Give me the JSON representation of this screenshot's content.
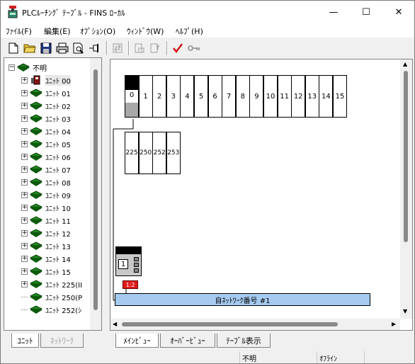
{
  "window": {
    "title": "PLCﾙｰﾁﾝｸﾞ ﾃｰﾌﾞﾙ - FINS ﾛｰｶﾙ",
    "minimize": "—",
    "maximize": "☐",
    "close": "✕"
  },
  "menu": [
    "ﾌｧｲﾙ(F)",
    "編集(E)",
    "ｵﾌﾟｼｮﾝ(O)",
    "ｳｨﾝﾄﾞｳ(W)",
    "ﾍﾙﾌﾟ(H)"
  ],
  "tree": {
    "root": "不明",
    "items": [
      "ﾕﾆｯﾄ 00",
      "ﾕﾆｯﾄ 01",
      "ﾕﾆｯﾄ 02",
      "ﾕﾆｯﾄ 03",
      "ﾕﾆｯﾄ 04",
      "ﾕﾆｯﾄ 05",
      "ﾕﾆｯﾄ 06",
      "ﾕﾆｯﾄ 07",
      "ﾕﾆｯﾄ 08",
      "ﾕﾆｯﾄ 09",
      "ﾕﾆｯﾄ 10",
      "ﾕﾆｯﾄ 11",
      "ﾕﾆｯﾄ 12",
      "ﾕﾆｯﾄ 13",
      "ﾕﾆｯﾄ 14",
      "ﾕﾆｯﾄ 15",
      "ﾕﾆｯﾄ 225(II",
      "ﾕﾆｯﾄ 250(P",
      "ﾕﾆｯﾄ 252(ｼ"
    ]
  },
  "left_tabs": [
    "ﾕﾆｯﾄ",
    "ﾈｯﾄﾜｰｸ"
  ],
  "main_tabs": [
    "ﾒｲﾝﾋﾞｭｰ",
    "ｵｰﾊﾞｰﾋﾞｭｰ",
    "ﾃｰﾌﾞﾙ表示"
  ],
  "rack": {
    "slots_row1": [
      "0",
      "1",
      "2",
      "3",
      "4",
      "5",
      "6",
      "7",
      "8",
      "9",
      "10",
      "11",
      "12",
      "13",
      "14",
      "15"
    ],
    "slots_row2": [
      "225",
      "250",
      "252",
      "253"
    ],
    "node_unit": "1",
    "node_badge": "1:2",
    "network_label": "自ﾈｯﾄﾜｰｸ番号  #1"
  },
  "status": {
    "cell1": "",
    "cell2": "不明",
    "cell3": "ｵﾌﾗｲﾝ"
  }
}
